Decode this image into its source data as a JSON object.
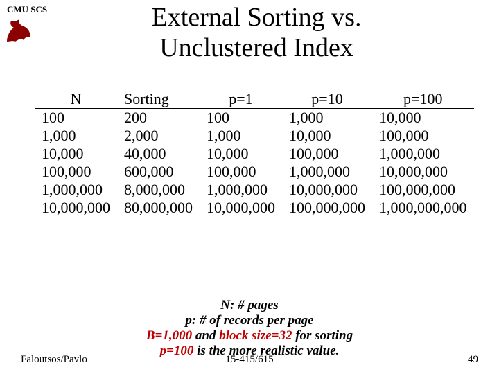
{
  "header": {
    "org": "CMU SCS"
  },
  "title_l1": "External Sorting vs.",
  "title_l2": "Unclustered Index",
  "table": {
    "headers": {
      "n": "N",
      "sort": "Sorting",
      "p1": "p=1",
      "p10": "p=10",
      "p100": "p=100"
    },
    "rows": [
      {
        "n": "100",
        "sort": "200",
        "p1": "100",
        "p10": "1,000",
        "p100": "10,000"
      },
      {
        "n": "1,000",
        "sort": "2,000",
        "p1": "1,000",
        "p10": "10,000",
        "p100": "100,000"
      },
      {
        "n": "10,000",
        "sort": "40,000",
        "p1": "10,000",
        "p10": "100,000",
        "p100": "1,000,000"
      },
      {
        "n": "100,000",
        "sort": "600,000",
        "p1": "100,000",
        "p10": "1,000,000",
        "p100": "10,000,000"
      },
      {
        "n": "1,000,000",
        "sort": "8,000,000",
        "p1": "1,000,000",
        "p10": "10,000,000",
        "p100": "100,000,000"
      },
      {
        "n": "10,000,000",
        "sort": "80,000,000",
        "p1": "10,000,000",
        "p10": "100,000,000",
        "p100": "1,000,000,000"
      }
    ]
  },
  "legend": {
    "l1a": "N",
    "l1b": ": # pages",
    "l2a": "p",
    "l2b": ": # of records per page",
    "l3a": "B=1,000",
    "l3b": " and ",
    "l3c": "block size=32",
    "l3d": " for sorting",
    "l4a": "p=100",
    "l4b": " is the more realistic value."
  },
  "footer": {
    "left": "Faloutsos/Pavlo",
    "center": "15-415/615",
    "right": "49"
  }
}
